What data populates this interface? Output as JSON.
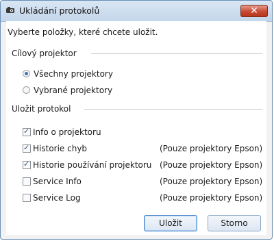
{
  "window": {
    "title": "Ukládání protokolů",
    "close_glyph": "✕"
  },
  "instruction": "Vyberte položky, které chcete uložit.",
  "target_group": {
    "heading": "Cílový projektor",
    "options": [
      {
        "label": "Všechny projektory",
        "selected": true
      },
      {
        "label": "Vybrané projektory",
        "selected": false
      }
    ]
  },
  "save_group": {
    "heading": "Uložit protokol",
    "items": [
      {
        "label": "Info o projektoru",
        "checked": true,
        "note": ""
      },
      {
        "label": "Historie chyb",
        "checked": true,
        "note": "(Pouze projektory Epson)"
      },
      {
        "label": "Historie používání projektoru",
        "checked": true,
        "note": "(Pouze projektory Epson)"
      },
      {
        "label": "Service Info",
        "checked": false,
        "note": "(Pouze projektory Epson)"
      },
      {
        "label": "Service Log",
        "checked": false,
        "note": "(Pouze projektory Epson)"
      }
    ]
  },
  "buttons": {
    "save": "Uložit",
    "cancel": "Storno"
  }
}
